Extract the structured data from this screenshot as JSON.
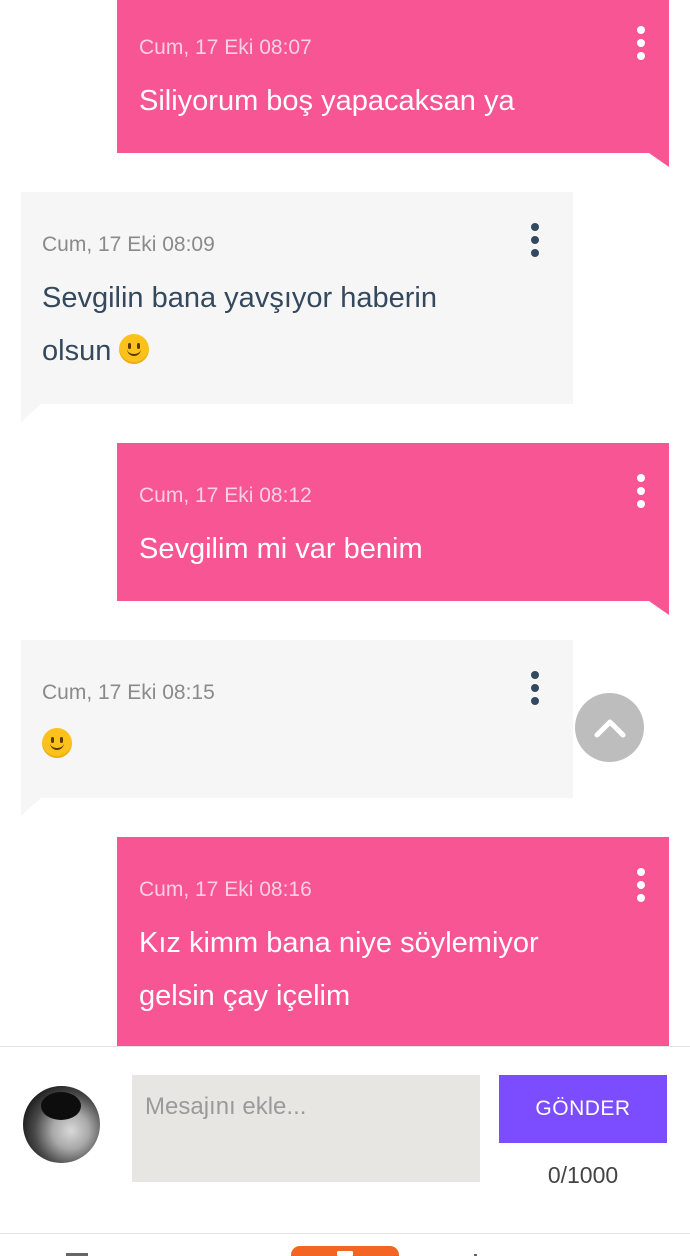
{
  "messages": [
    {
      "direction": "sent",
      "timestamp": "Cum, 17 Eki 08:07",
      "text": "Siliyorum boş yapacaksan ya",
      "emoji": ""
    },
    {
      "direction": "received",
      "timestamp": "Cum, 17 Eki 08:09",
      "text": "Sevgilin bana yavşıyor haberin\nolsun",
      "emoji": "slightly-smiling-face"
    },
    {
      "direction": "sent",
      "timestamp": "Cum, 17 Eki 08:12",
      "text": "Sevgilim mi var benim",
      "emoji": ""
    },
    {
      "direction": "received",
      "timestamp": "Cum, 17 Eki 08:15",
      "text": "",
      "emoji": "slightly-smiling-face"
    },
    {
      "direction": "sent",
      "timestamp": "Cum, 17 Eki 08:16",
      "text": "Kız kimm bana niye söylemiyor\ngelsin çay içelim",
      "emoji": ""
    }
  ],
  "composer": {
    "placeholder": "Mesajını ekle...",
    "value": "",
    "send_label": "GÖNDER",
    "counter": "0/1000"
  },
  "colors": {
    "sent_bubble": "#f75593",
    "received_bubble": "#f6f6f6",
    "send_button": "#7c4dff",
    "received_text": "#34495e",
    "scroll_button": "#bdbdbd",
    "bottom_nav_accent": "#f26522"
  },
  "icons": {
    "message_menu": "kebab-icon",
    "scroll_top": "chevron-up-icon"
  }
}
